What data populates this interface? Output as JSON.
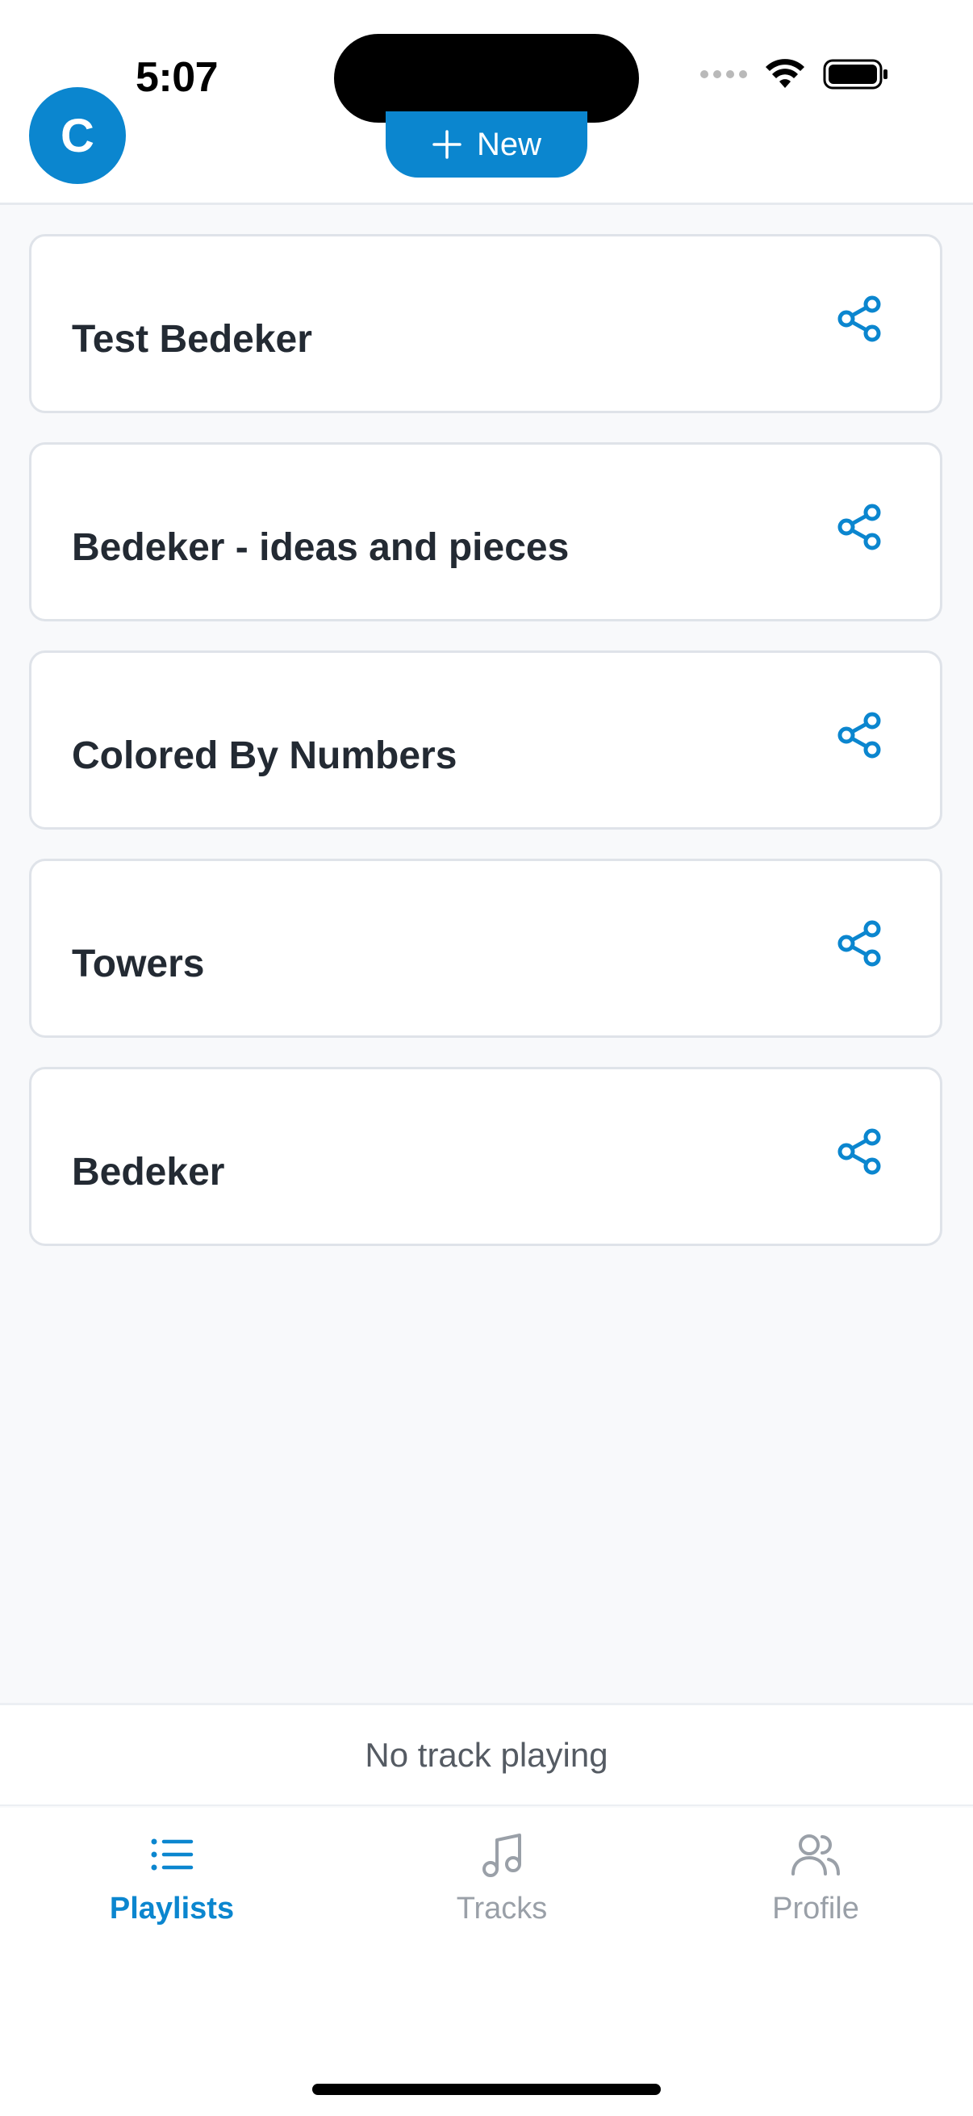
{
  "status_bar": {
    "time": "5:07"
  },
  "header": {
    "avatar_initial": "C",
    "new_button_label": "New"
  },
  "playlists": [
    {
      "title": "Test Bedeker"
    },
    {
      "title": "Bedeker - ideas and pieces"
    },
    {
      "title": "Colored By Numbers"
    },
    {
      "title": "Towers"
    },
    {
      "title": "Bedeker"
    }
  ],
  "player": {
    "status": "No track playing"
  },
  "tabs": [
    {
      "label": "Playlists",
      "icon": "list-icon",
      "active": true
    },
    {
      "label": "Tracks",
      "icon": "music-note-icon",
      "active": false
    },
    {
      "label": "Profile",
      "icon": "users-icon",
      "active": false
    }
  ],
  "colors": {
    "accent": "#0b86cf",
    "background": "#f8f9fb",
    "inactive_tab": "#9aa0a8"
  }
}
